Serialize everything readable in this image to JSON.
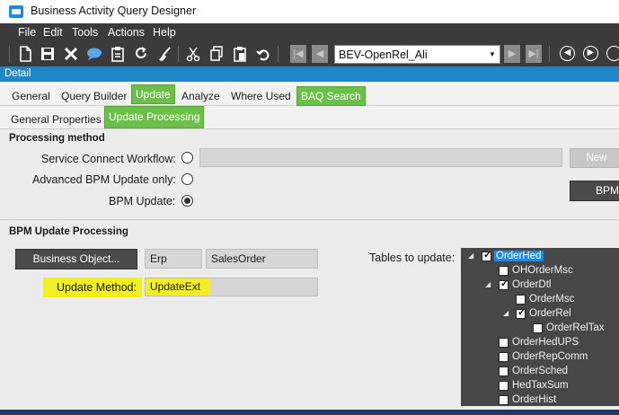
{
  "window": {
    "title": "Business Activity Query Designer"
  },
  "menu": [
    "File",
    "Edit",
    "Tools",
    "Actions",
    "Help"
  ],
  "toolbar": {
    "icons": [
      "new-icon",
      "save-icon",
      "delete-icon",
      "comment-icon",
      "clipboard-icon",
      "refresh-icon",
      "clear-icon",
      "cut-icon",
      "copy-icon",
      "paste-icon",
      "undo-icon"
    ],
    "query_combo": "BEV-OpenRel_Ali"
  },
  "detail_label": "Detail",
  "tabs": [
    "General",
    "Query Builder",
    "Update",
    "Analyze",
    "Where Used",
    "BAQ Search"
  ],
  "subtabs": [
    "General Properties",
    "Update  Processing"
  ],
  "processing": {
    "header": "Processing method",
    "service_connect_label": "Service Connect Workflow:",
    "advanced_bpm_label": "Advanced BPM Update only:",
    "bpm_update_label": "BPM Update:",
    "selected": "bpm_update",
    "new_button": "New",
    "bpm_button": "BPM"
  },
  "bpm_processing": {
    "header": "BPM Update Processing",
    "business_object_button": "Business Object...",
    "erp_value": "Erp",
    "object_value": "SalesOrder",
    "update_method_label": "Update Method:",
    "update_method_value": "UpdateExt",
    "tables_label": "Tables to update:"
  },
  "tree": [
    {
      "label": "OrderHed",
      "checked": true,
      "level": 0,
      "expanded": true,
      "selected": true
    },
    {
      "label": "OHOrderMsc",
      "checked": false,
      "level": 1
    },
    {
      "label": "OrderDtl",
      "checked": true,
      "level": 1,
      "expanded": true
    },
    {
      "label": "OrderMsc",
      "checked": false,
      "level": 2
    },
    {
      "label": "OrderRel",
      "checked": true,
      "level": 2,
      "expanded": true
    },
    {
      "label": "OrderRelTax",
      "checked": false,
      "level": 3
    },
    {
      "label": "OrderHedUPS",
      "checked": false,
      "level": 1
    },
    {
      "label": "OrderRepComm",
      "checked": false,
      "level": 1
    },
    {
      "label": "OrderSched",
      "checked": false,
      "level": 1
    },
    {
      "label": "HedTaxSum",
      "checked": false,
      "level": 1
    },
    {
      "label": "OrderHist",
      "checked": false,
      "level": 1
    }
  ],
  "colors": {
    "accent_green": "#6cc04a",
    "detail_blue": "#1f86c8",
    "highlight_yellow": "#f3f021"
  }
}
